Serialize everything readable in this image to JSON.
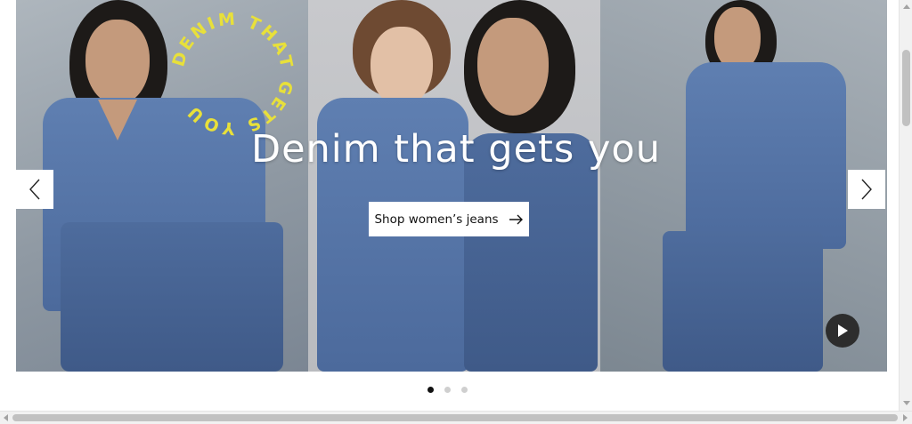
{
  "hero": {
    "headline": "Denim that gets you",
    "circle_text": "DENIM THAT GETS YOU",
    "cta_label": "Shop women’s jeans",
    "arrow_icon": "arrow-right-icon",
    "prev_icon": "chevron-left-icon",
    "next_icon": "chevron-right-icon",
    "play_icon": "play-icon",
    "accent_color": "#e8e03a"
  },
  "carousel": {
    "slide_count": 3,
    "active_index": 0
  }
}
